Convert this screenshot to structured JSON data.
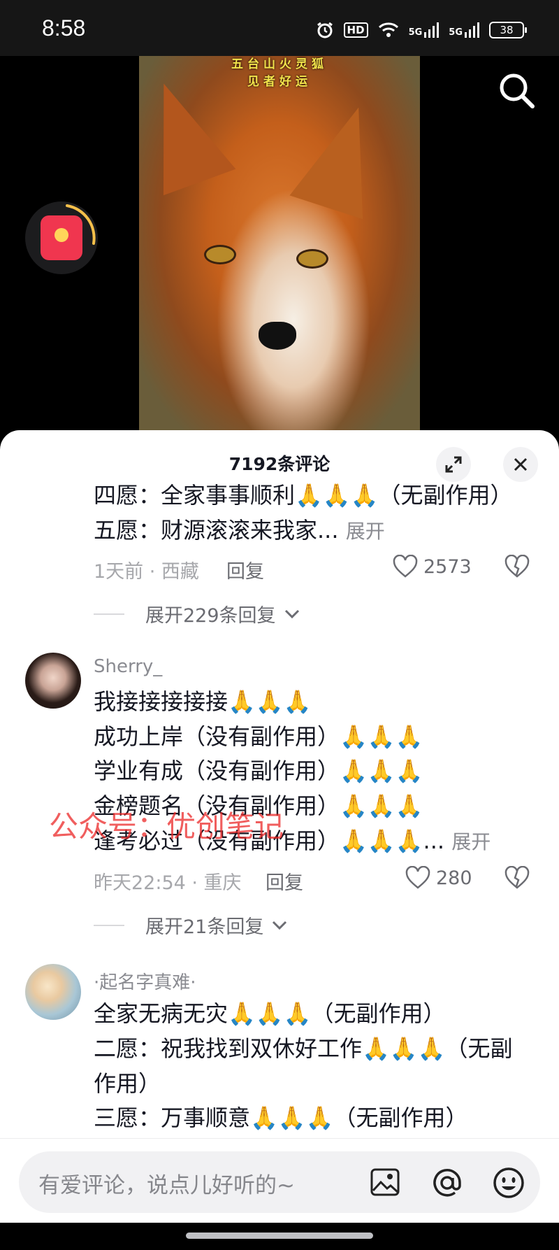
{
  "status_bar": {
    "time": "8:58",
    "hd_label": "HD",
    "network_1": "5G",
    "network_2": "5G",
    "battery": "38",
    "icons": [
      "alarm-icon",
      "hd-icon",
      "wifi-icon",
      "signal-5g-icon",
      "signal-5g-icon",
      "battery-icon"
    ]
  },
  "video": {
    "caption_line1": "五台山火灵狐",
    "caption_line2": "见者好运",
    "search_icon": "search-icon",
    "redpacket_icon": "red-envelope-icon"
  },
  "comments_sheet": {
    "title": "7192条评论",
    "expand_icon": "expand-icon",
    "close_icon": "close-icon",
    "comments": [
      {
        "lines": [
          "四愿：全家事事顺利🙏🙏🙏（无副作用）",
          "五愿：财源滚滚来我家..."
        ],
        "expand_label": "展开",
        "time_location": "1天前 · 西藏",
        "reply_label": "回复",
        "like_count": "2573",
        "more_replies": "展开229条回复"
      },
      {
        "username": "Sherry_",
        "lines": [
          "我接接接接接🙏🙏🙏",
          "成功上岸（没有副作用）🙏🙏🙏",
          "学业有成（没有副作用）🙏🙏🙏",
          "金榜题名（没有副作用）🙏🙏🙏",
          "逢考必过（没有副作用）🙏🙏🙏..."
        ],
        "expand_label": "展开",
        "time_location": "昨天22:54 · 重庆",
        "reply_label": "回复",
        "like_count": "280",
        "more_replies": "展开21条回复"
      },
      {
        "username": "·起名字真难·",
        "lines": [
          "全家无病无灾🙏🙏🙏（无副作用）",
          "二愿：祝我找到双休好工作🙏🙏🙏（无副",
          "作用）",
          "三愿：万事顺意🙏🙏🙏（无副作用）"
        ]
      }
    ],
    "watermark": "公众号：优创笔记"
  },
  "input_bar": {
    "placeholder": "有爱评论，说点儿好听的~",
    "icons": [
      "image-icon",
      "at-icon",
      "emoji-icon"
    ]
  },
  "colors": {
    "accent_red": "#f0364f",
    "text_primary": "#161823",
    "text_secondary": "#8a8b91"
  }
}
